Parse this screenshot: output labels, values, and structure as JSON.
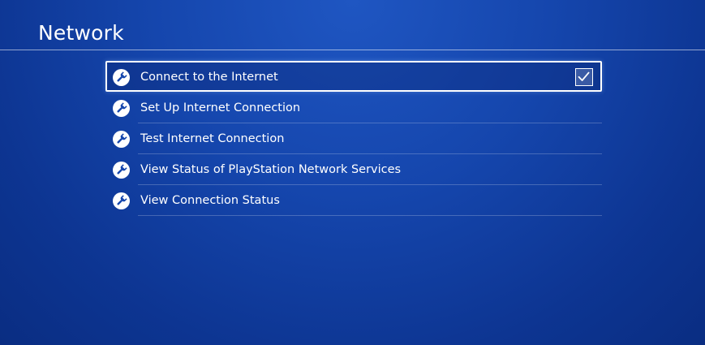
{
  "page": {
    "title": "Network"
  },
  "menu": {
    "items": [
      {
        "label": "Connect to the Internet",
        "icon": "wrench-icon",
        "checked": true,
        "selected": true
      },
      {
        "label": "Set Up Internet Connection",
        "icon": "wrench-icon"
      },
      {
        "label": "Test Internet Connection",
        "icon": "wrench-icon"
      },
      {
        "label": "View Status of PlayStation Network Services",
        "icon": "wrench-icon"
      },
      {
        "label": "View Connection Status",
        "icon": "wrench-icon"
      }
    ]
  },
  "colors": {
    "background": "#1546ad",
    "text": "#ffffff",
    "focus_border": "#ffffff"
  }
}
